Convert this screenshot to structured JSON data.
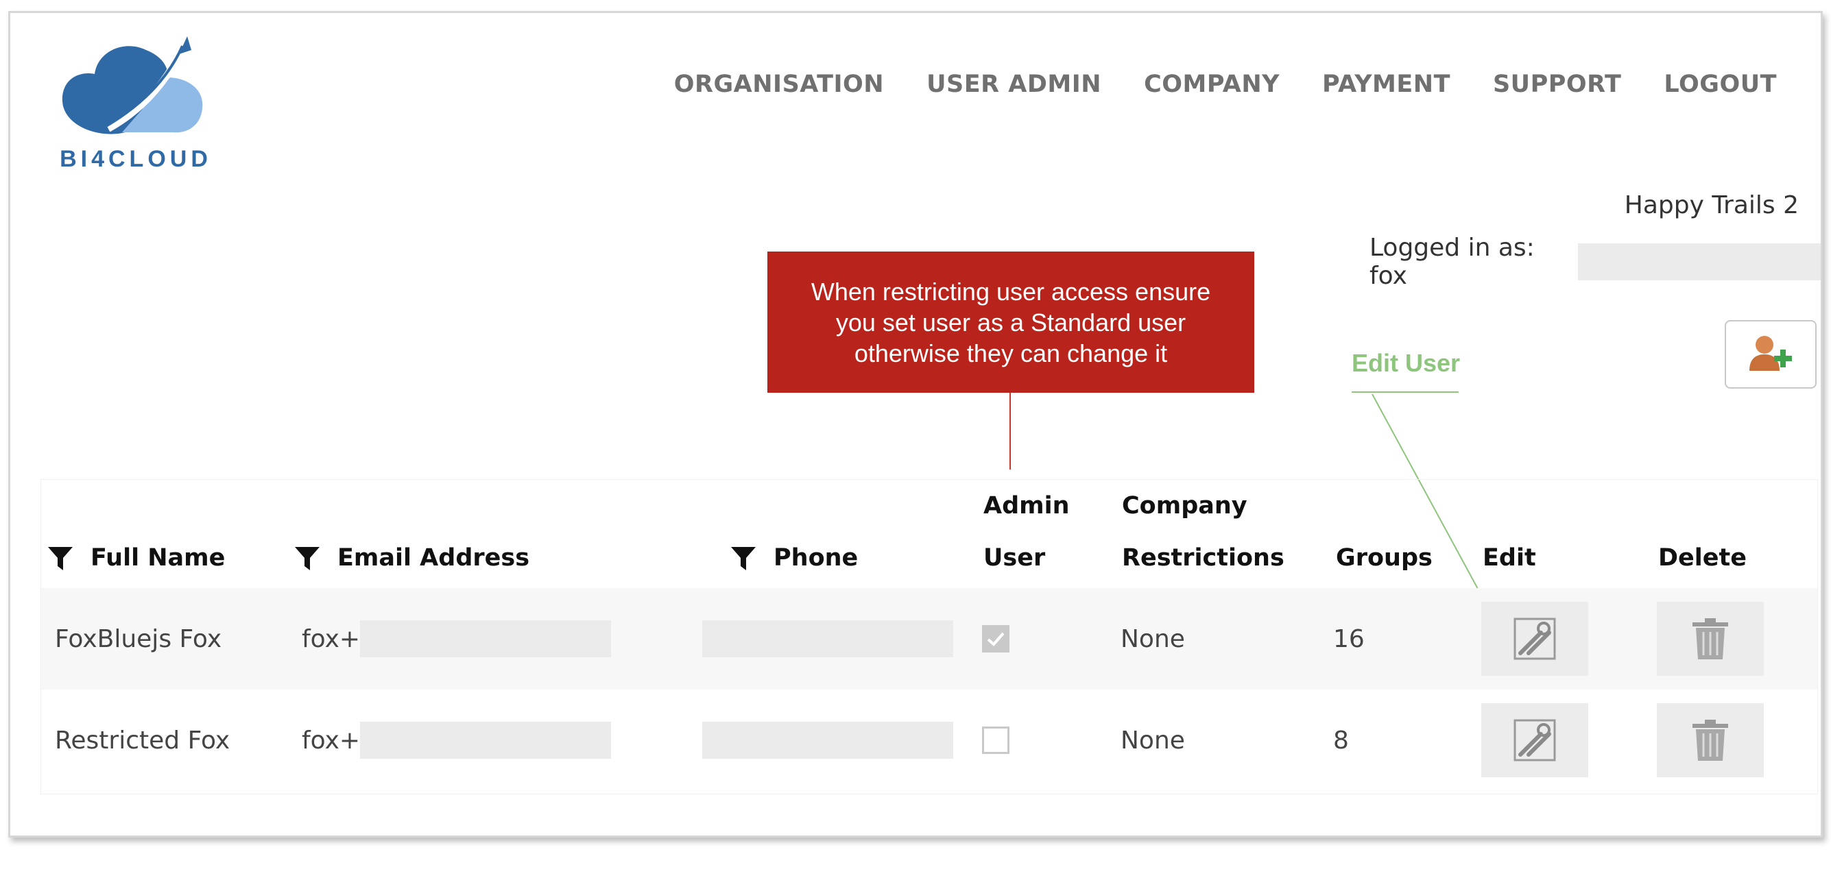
{
  "brand": {
    "logo_text": "BI4CLOUD"
  },
  "nav": {
    "items": [
      "ORGANISATION",
      "USER ADMIN",
      "COMPANY",
      "PAYMENT",
      "SUPPORT",
      "LOGOUT"
    ]
  },
  "account": {
    "company_name": "Happy Trails 2",
    "logged_in_label": "Logged in as: fox"
  },
  "annotations": {
    "callout_text": "When restricting user access ensure you set user as a Standard user otherwise they can change it",
    "edit_user_label": "Edit User"
  },
  "table": {
    "headers": {
      "full_name": "Full Name",
      "email": "Email Address",
      "phone": "Phone",
      "admin_line1": "Admin",
      "admin_line2": "User",
      "company_line1": "Company",
      "company_line2": "Restrictions",
      "groups": "Groups",
      "edit": "Edit",
      "delete": "Delete"
    },
    "rows": [
      {
        "full_name": "FoxBluejs Fox",
        "email_prefix": "fox+",
        "admin": true,
        "restrictions": "None",
        "groups": "16"
      },
      {
        "full_name": "Restricted Fox",
        "email_prefix": "fox+",
        "admin": false,
        "restrictions": "None",
        "groups": "8"
      }
    ]
  },
  "colors": {
    "callout_bg": "#b8241c",
    "annotation_green": "#8dc57c",
    "brand_blue": "#2f6aa6"
  }
}
